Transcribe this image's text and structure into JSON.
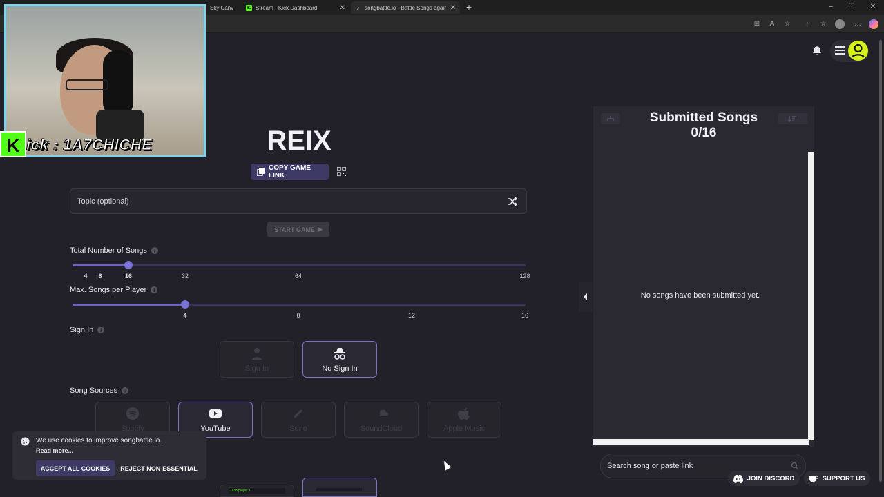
{
  "browser": {
    "tabs": [
      {
        "label": "Sky Canv",
        "active": false
      },
      {
        "label": "Stream - Kick Dashboard",
        "active": false
      },
      {
        "label": "songbattle.io - Battle Songs again",
        "active": true
      }
    ],
    "new_tab": "+",
    "window_controls": [
      "–",
      "❐",
      "✕"
    ]
  },
  "webcam": {
    "overlay_logo": "K",
    "overlay_text": "ick : 1A7CHICHE"
  },
  "main": {
    "title": "REIX",
    "copy_link_label": "COPY GAME LINK",
    "topic_placeholder": "Topic (optional)",
    "start_label": "START GAME",
    "total_songs": {
      "label": "Total Number of Songs",
      "ticks": [
        "4",
        "8",
        "16",
        "32",
        "64",
        "128"
      ],
      "selected": "16"
    },
    "max_songs": {
      "label": "Max. Songs per Player",
      "ticks": [
        "4",
        "8",
        "12",
        "16"
      ],
      "selected": "4"
    },
    "sign_in": {
      "label": "Sign In",
      "options": [
        {
          "label": "Sign In",
          "selected": false,
          "icon": "person-icon"
        },
        {
          "label": "No Sign In",
          "selected": true,
          "icon": "incognito-icon"
        }
      ]
    },
    "song_sources": {
      "label": "Song Sources",
      "options": [
        {
          "label": "Spotify",
          "selected": false,
          "icon": "spotify-icon"
        },
        {
          "label": "YouTube",
          "selected": true,
          "icon": "youtube-icon"
        },
        {
          "label": "Suno",
          "selected": false,
          "icon": "suno-icon"
        },
        {
          "label": "SoundCloud",
          "selected": false,
          "icon": "soundcloud-icon"
        },
        {
          "label": "Apple Music",
          "selected": false,
          "icon": "apple-icon"
        }
      ]
    },
    "preview_text": "0:33 player 1"
  },
  "cookie": {
    "message": "We use cookies to improve songbattle.io.",
    "read_more": "Read more...",
    "accept": "ACCEPT ALL COOKIES",
    "reject": "REJECT NON-ESSENTIAL"
  },
  "panel": {
    "title": "Submitted Songs",
    "count": "0/16",
    "empty": "No songs have been submitted yet.",
    "search_placeholder": "Search song or paste link"
  },
  "footer": {
    "discord": "JOIN DISCORD",
    "support": "SUPPORT US"
  },
  "colors": {
    "accent": "#7a72d6",
    "background": "#222129",
    "kick_green": "#53fc18",
    "avatar": "#d6f21a"
  }
}
